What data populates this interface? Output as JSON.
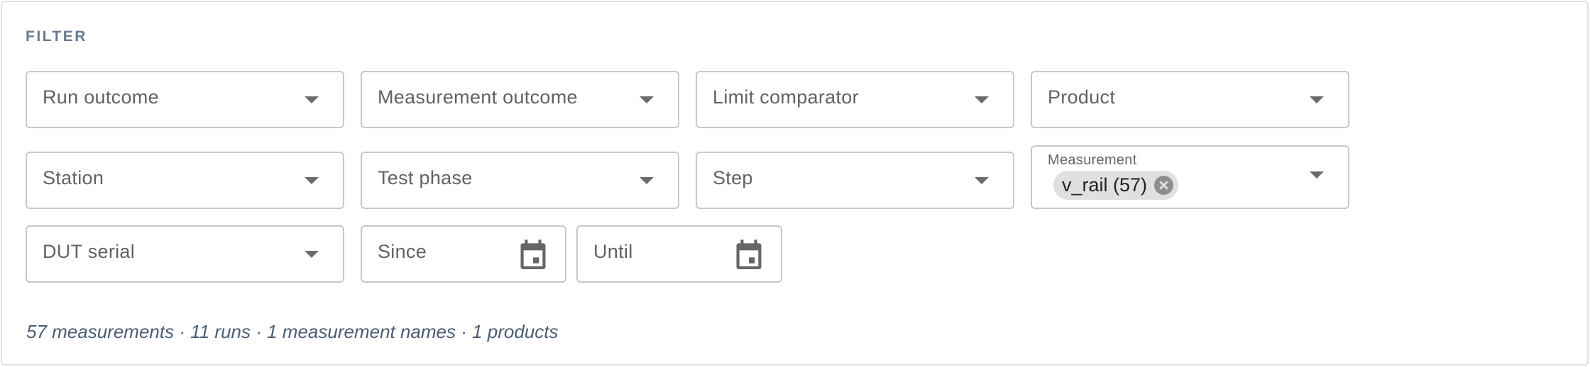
{
  "filter": {
    "heading": "FILTER",
    "fields": {
      "run_outcome": "Run outcome",
      "measurement_outcome": "Measurement outcome",
      "limit_comparator": "Limit comparator",
      "product": "Product",
      "station": "Station",
      "test_phase": "Test phase",
      "step": "Step",
      "dut_serial": "DUT serial",
      "since": "Since",
      "until": "Until"
    },
    "measurement": {
      "label": "Measurement",
      "chip": "v_rail (57)"
    },
    "summary": "57 measurements · 11 runs · 1 measurement names · 1 products"
  },
  "icons": {
    "dropdown": "caret-down-icon",
    "calendar": "calendar-icon",
    "chip_remove": "cancel-circle-icon"
  },
  "colors": {
    "heading": "#687a91",
    "border": "#c8c8c8",
    "chip_bg": "#e0e0e0",
    "summary": "#4a5d75"
  }
}
